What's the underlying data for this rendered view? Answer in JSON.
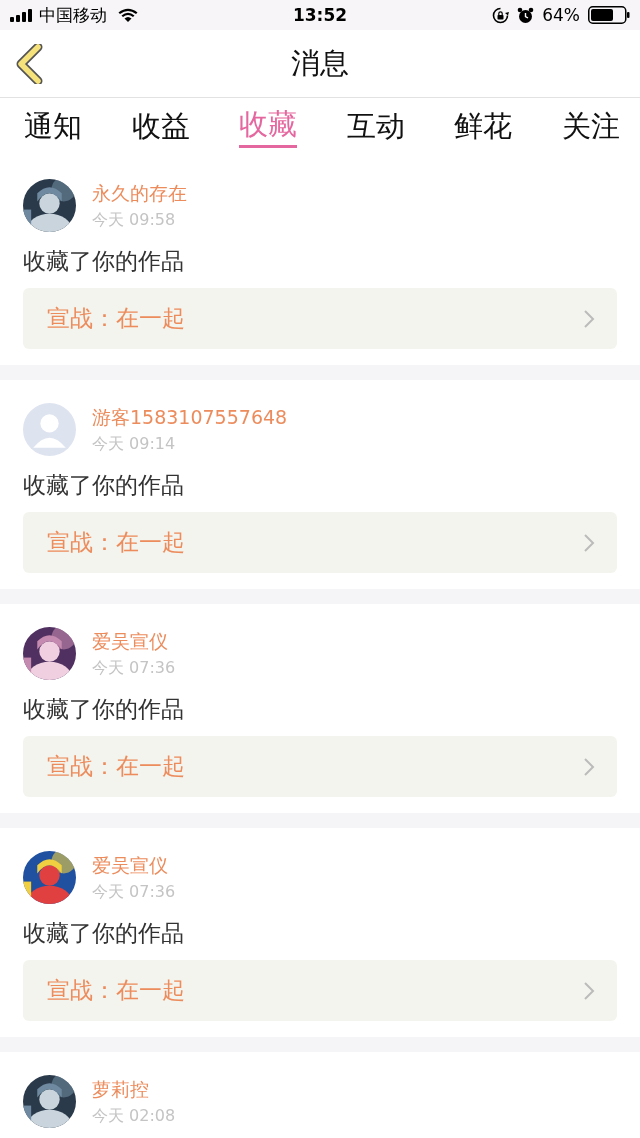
{
  "status_bar": {
    "carrier": "中国移动",
    "time": "13:52",
    "battery": "64%"
  },
  "nav": {
    "title": "消息"
  },
  "tabs": [
    {
      "label": "通知",
      "selected": false
    },
    {
      "label": "收益",
      "selected": false
    },
    {
      "label": "收藏",
      "selected": true
    },
    {
      "label": "互动",
      "selected": false
    },
    {
      "label": "鲜花",
      "selected": false
    },
    {
      "label": "关注",
      "selected": false
    }
  ],
  "messages": [
    {
      "name": "永久的存在",
      "time": "今天 09:58",
      "text": "收藏了你的作品",
      "work": "宣战：在一起"
    },
    {
      "avatar": {
        "kind": "default"
      },
      "name": "游客1583107557648",
      "time": "今天 09:14",
      "text": "收藏了你的作品",
      "work": "宣战：在一起"
    },
    {
      "name": "爱吴宣仪",
      "time": "今天 07:36",
      "text": "收藏了你的作品",
      "work": "宣战：在一起"
    },
    {
      "name": "爱吴宣仪",
      "time": "今天 07:36",
      "text": "收藏了你的作品",
      "work": "宣战：在一起"
    },
    {
      "name": "萝莉控",
      "time": "今天 02:08"
    }
  ]
}
